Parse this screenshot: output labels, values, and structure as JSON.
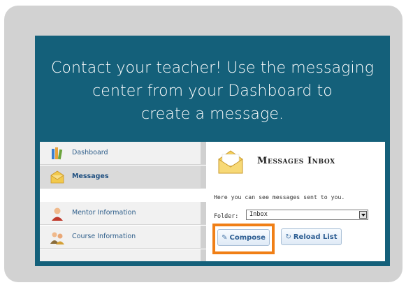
{
  "headline": {
    "line1": "Contact your teacher!  Use the messaging",
    "line2": "center from your Dashboard to",
    "line3": "create a message."
  },
  "nav": {
    "items": [
      {
        "label": "Dashboard",
        "icon": "books-icon"
      },
      {
        "label": "Messages",
        "icon": "envelope-icon",
        "active": true
      },
      {
        "label": "Mentor Information",
        "icon": "person-icon"
      },
      {
        "label": "Course Information",
        "icon": "people-icon"
      }
    ]
  },
  "inbox": {
    "title": "Messages Inbox",
    "description": "Here you can see messages sent to you.",
    "folder_label": "Folder:",
    "folder_value": "Inbox",
    "compose_label": "Compose",
    "reload_label": "Reload List"
  },
  "colors": {
    "outer": "#d2d2d2",
    "panel": "#14607a",
    "highlight": "#f07f16"
  }
}
